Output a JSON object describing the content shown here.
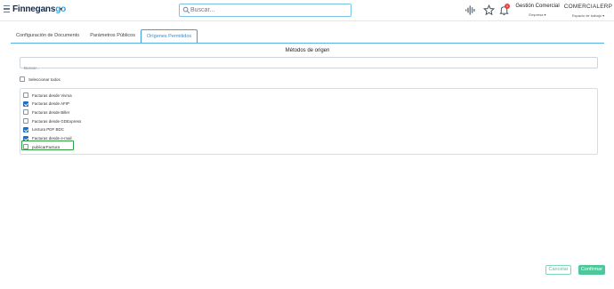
{
  "header": {
    "logo_text": "Finnegans",
    "logo_suffix": "go",
    "search_placeholder": "Buscar...",
    "notification_count": "1",
    "company_name": "Gestión Comercial",
    "company_selector": "Empresa",
    "workspace_name": "COMERCIALERP",
    "workspace_selector": "Espacio de trabajo"
  },
  "tabs": [
    {
      "label": "Configuración de Documento",
      "active": false
    },
    {
      "label": "Parámetros Públicos",
      "active": false
    },
    {
      "label": "Orígenes Permitidos",
      "active": true
    }
  ],
  "section": {
    "title": "Métodos de origen",
    "filter_placeholder": "Buscar...",
    "select_all_label": "Seleccionar todos",
    "select_all_checked": false
  },
  "methods": [
    {
      "label": "Facturas desde Vivma",
      "checked": false
    },
    {
      "label": "Facturas desde AFIP",
      "checked": true
    },
    {
      "label": "Facturas desde Biller",
      "checked": false
    },
    {
      "label": "Facturas desde GDExpress",
      "checked": false
    },
    {
      "label": "Lectura PDF BDC",
      "checked": true
    },
    {
      "label": "Facturas desde e-mail",
      "checked": true
    },
    {
      "label": "publicarFactura",
      "checked": false,
      "highlighted": true
    }
  ],
  "footer": {
    "cancel_label": "Cancelar",
    "confirm_label": "Confirmar"
  },
  "colors": {
    "accent_blue": "#2b90d9",
    "checkbox_blue": "#1f6fc5",
    "highlight_green": "#2e9e3e",
    "confirm_green": "#4ec89a",
    "notification_red": "#e5413b"
  }
}
